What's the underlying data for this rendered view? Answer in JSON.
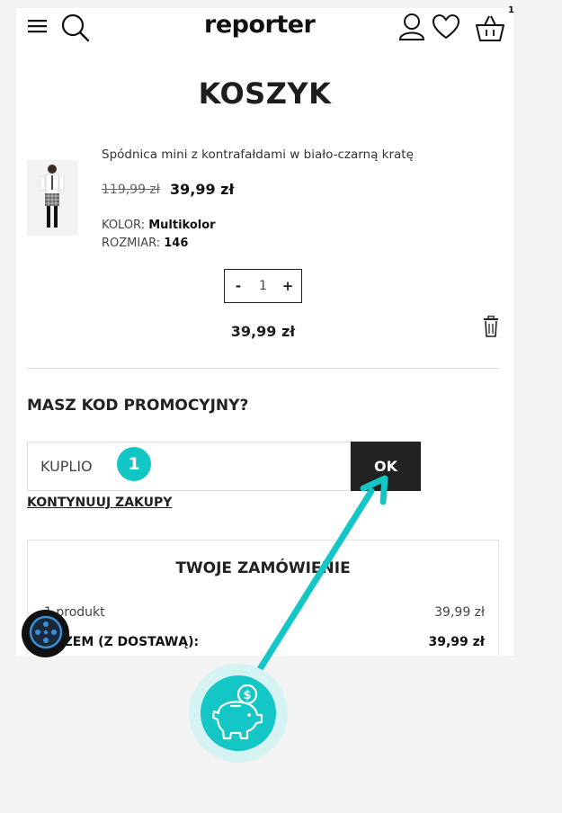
{
  "header": {
    "logo": "reporter",
    "cart_count": "1",
    "icons": [
      "menu-icon",
      "search-icon",
      "user-icon",
      "heart-icon",
      "basket-icon"
    ]
  },
  "page_title": "KOSZYK",
  "product": {
    "name": "Spódnica mini z kontrafałdami w biało-czarną kratę",
    "old_price": "119,99 zł",
    "new_price": "39,99 zł",
    "color_label": "KOLOR: ",
    "color_value": "Multikolor",
    "size_label": "ROZMIAR: ",
    "size_value": "146",
    "qty_minus": "-",
    "qty_value": "1",
    "qty_plus": "+",
    "line_total": "39,99 zł"
  },
  "promo": {
    "title": "MASZ KOD PROMOCYJNY?",
    "input_value": "KUPLIO",
    "ok_label": "OK",
    "badge": "1"
  },
  "continue_label": "KONTYNUUJ ZAKUPY",
  "summary": {
    "title": "TWOJE ZAMÓWIENIE",
    "rows": [
      {
        "label": "1 produkt",
        "value": "39,99 zł"
      },
      {
        "label": "RAZEM (Z DOSTAWĄ):",
        "value": "39,99 zł"
      }
    ]
  },
  "colors": {
    "accent": "#15c6c6",
    "dark": "#222222"
  }
}
